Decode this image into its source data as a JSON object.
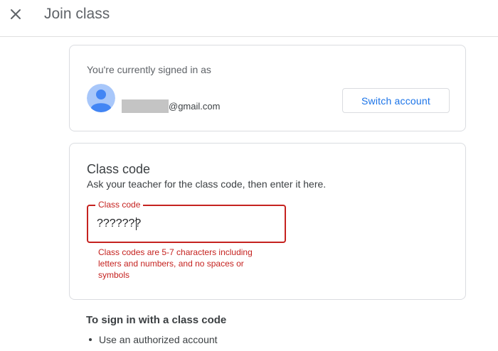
{
  "header": {
    "title": "Join class",
    "close_icon": "close-icon"
  },
  "account": {
    "signed_in_label": "You're currently signed in as",
    "email_domain": "@gmail.com",
    "switch_label": "Switch account",
    "avatar_icon": "person-icon"
  },
  "class_code": {
    "heading": "Class code",
    "instructions": "Ask your teacher for the class code, then enter it here.",
    "field_label": "Class code",
    "field_value": "???????",
    "error": "Class codes are 5-7 characters including letters and numbers, and no spaces or symbols"
  },
  "signin_help": {
    "heading": "To sign in with a class code",
    "items": [
      "Use an authorized account"
    ]
  },
  "colors": {
    "accent": "#1a73e8",
    "error": "#c5221f",
    "border": "#dadce0"
  }
}
